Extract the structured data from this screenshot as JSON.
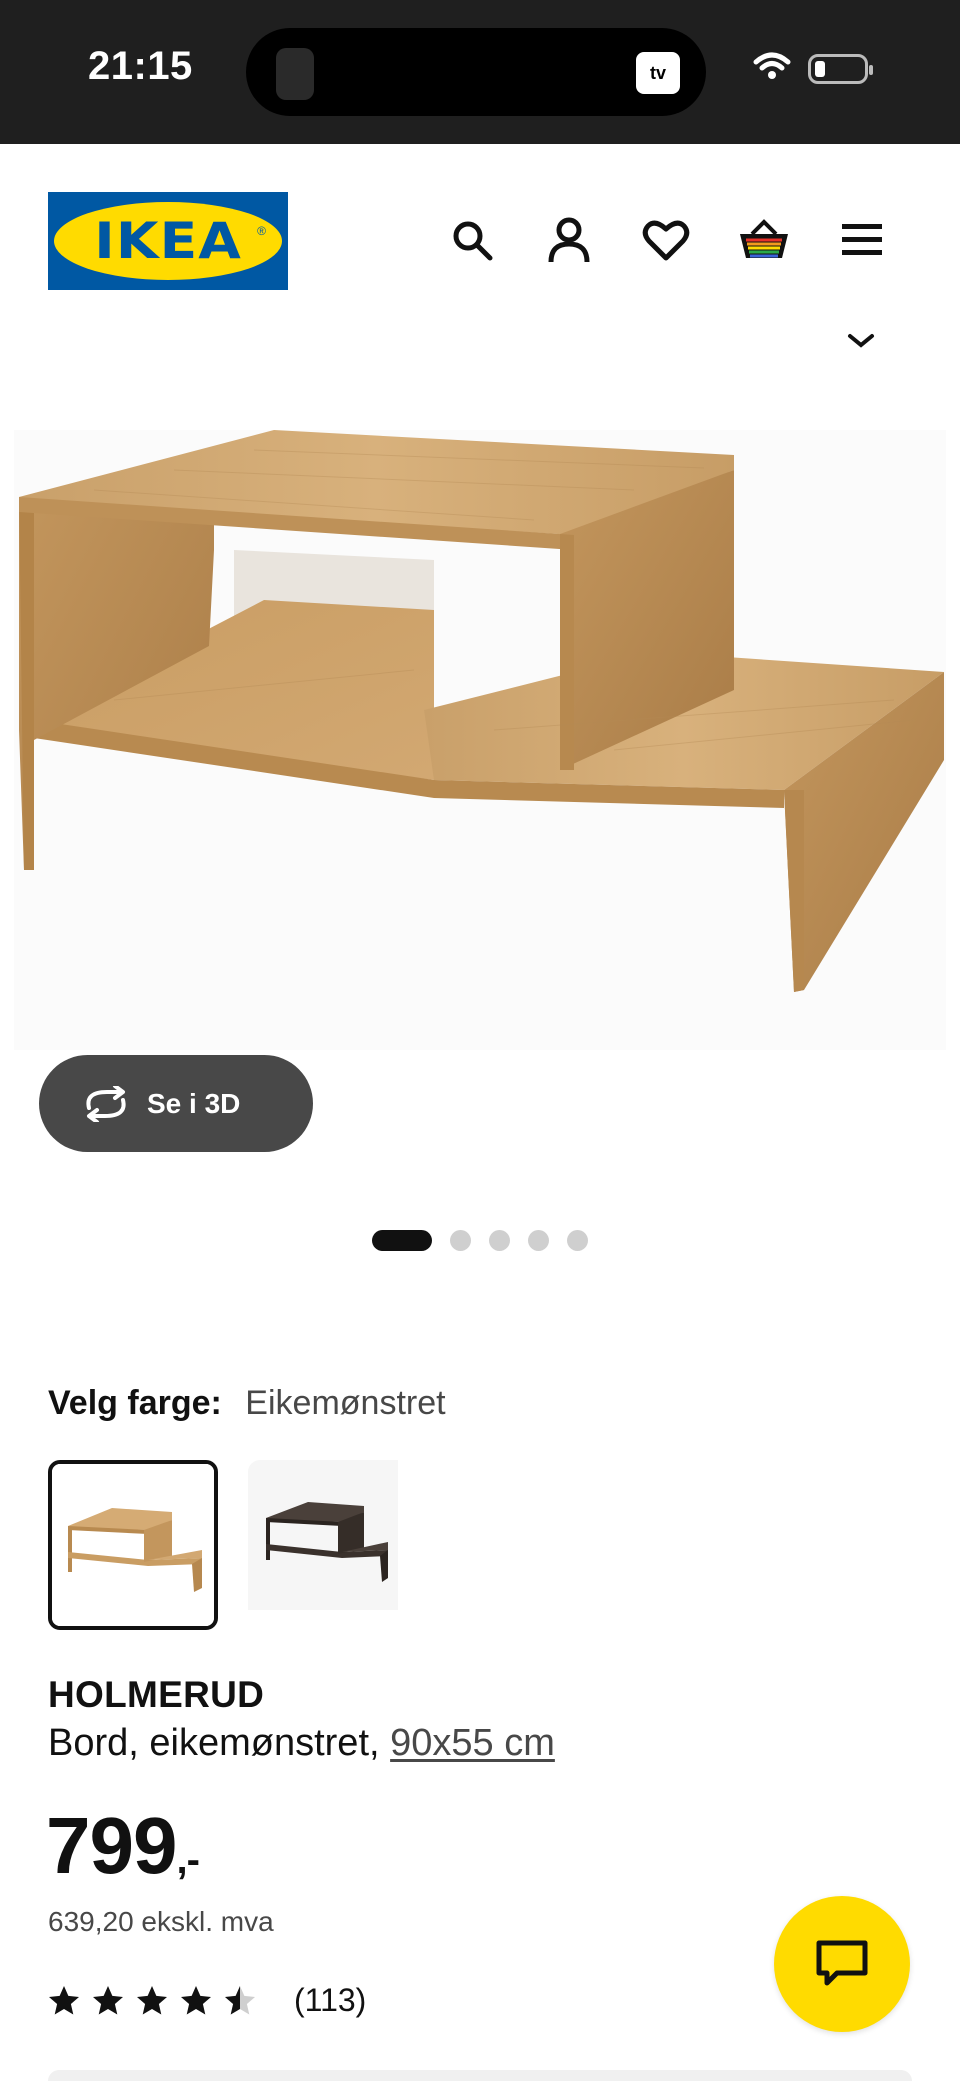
{
  "status_bar": {
    "time": "21:15",
    "app_badge": "tv"
  },
  "header": {
    "logo_text": "IKEA",
    "icons": [
      "search-icon",
      "profile-icon",
      "heart-icon",
      "cart-icon",
      "menu-icon"
    ]
  },
  "gallery": {
    "button_3d_label": "Se i 3D",
    "total_images": 5,
    "active_index": 0
  },
  "color": {
    "label": "Velg farge:",
    "value": "Eikemønstret",
    "options": [
      "oak-effect",
      "black-brown"
    ]
  },
  "product": {
    "name": "HOLMERUD",
    "description": "Bord, eikemønstret, ",
    "size": "90x55 cm",
    "price": "799",
    "price_suffix": ",-",
    "price_ex_vat": "639,20 ekskl. mva",
    "rating": 4.5,
    "review_count": "(113)"
  },
  "colors": {
    "ikea_blue": "#0058a3",
    "ikea_yellow": "#ffdb00",
    "button_dark": "#484848"
  }
}
